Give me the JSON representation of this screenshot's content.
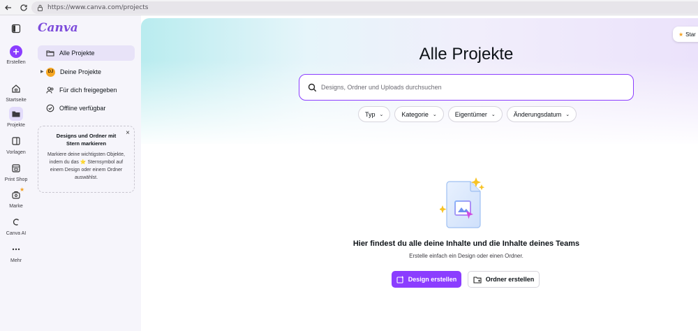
{
  "browser": {
    "url": "https://www.canva.com/projects",
    "back_icon": "back-arrow-icon",
    "reload_icon": "reload-icon",
    "lock_icon": "lock-icon"
  },
  "rail": {
    "toggle_icon": "sidebar-toggle-icon",
    "items": [
      {
        "label": "Erstellen",
        "icon": "plus-icon"
      },
      {
        "label": "Startseite",
        "icon": "home-icon"
      },
      {
        "label": "Projekte",
        "icon": "folder-icon"
      },
      {
        "label": "Vorlagen",
        "icon": "template-icon"
      },
      {
        "label": "Print Shop",
        "icon": "print-icon"
      },
      {
        "label": "Marke",
        "icon": "brand-icon"
      },
      {
        "label": "Canva AI",
        "icon": "ai-icon"
      },
      {
        "label": "Mehr",
        "icon": "more-icon"
      }
    ]
  },
  "sidebar": {
    "logo": "Canva",
    "items": [
      {
        "label": "Alle Projekte",
        "icon": "folder-icon"
      },
      {
        "label": "Deine Projekte",
        "avatar": "DJ"
      },
      {
        "label": "Für dich freigegeben",
        "icon": "people-icon"
      },
      {
        "label": "Offline verfügbar",
        "icon": "offline-icon"
      }
    ],
    "promo": {
      "title": "Designs und Ordner mit Stern markieren",
      "body_before": "Markiere deine wichtigsten Objekte, indem du das ",
      "star": "⭐",
      "body_after": " Sternsymbol auf einem Design oder einem Ordner auswählst.",
      "close": "×"
    }
  },
  "main": {
    "start_label": "Star",
    "title": "Alle Projekte",
    "search_placeholder": "Designs, Ordner und Uploads durchsuchen",
    "filters": [
      "Typ",
      "Kategorie",
      "Eigentümer",
      "Änderungsdatum"
    ],
    "empty_title": "Hier findest du alle deine Inhalte und die Inhalte deines Teams",
    "empty_subtitle": "Erstelle einfach ein Design oder einen Ordner.",
    "create_design": "Design erstellen",
    "create_folder": "Ordner erstellen"
  },
  "colors": {
    "accent": "#8b3dff",
    "logo": "#7d4cdb",
    "star": "#f4a020"
  }
}
